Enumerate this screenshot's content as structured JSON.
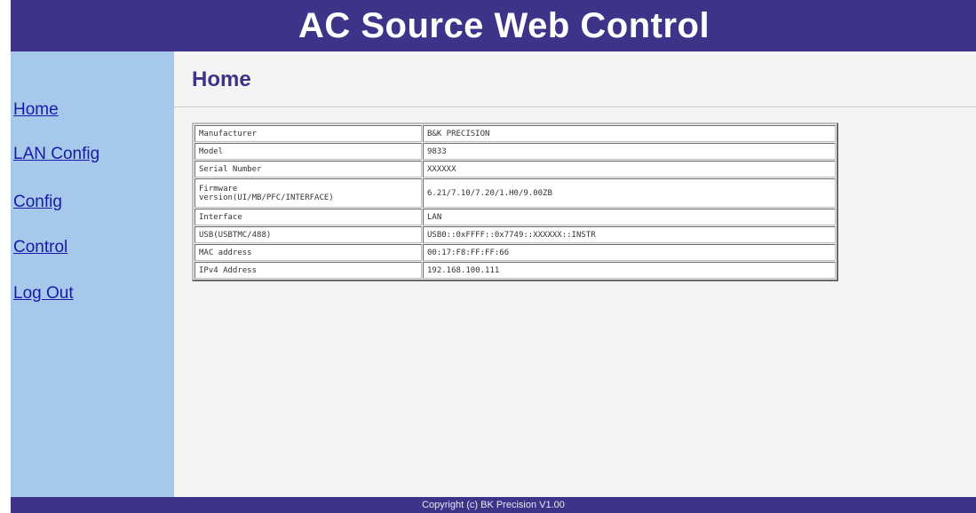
{
  "header": {
    "title": "AC Source Web Control"
  },
  "sidebar": {
    "items": [
      {
        "label": "Home"
      },
      {
        "label": "LAN Config"
      },
      {
        "label": "Config"
      },
      {
        "label": "Control"
      },
      {
        "label": "Log Out"
      }
    ]
  },
  "main": {
    "page_title": "Home",
    "table": {
      "rows": [
        {
          "label": "Manufacturer",
          "value": "B&K PRECISION"
        },
        {
          "label": "Model",
          "value": "9833"
        },
        {
          "label": "Serial Number",
          "value": "XXXXXX"
        },
        {
          "label_line1": "Firmware",
          "label_line2": "version(UI/MB/PFC/INTERFACE)",
          "value": "6.21/7.10/7.20/1.H0/9.00ZB"
        },
        {
          "label": "Interface",
          "value": "LAN"
        },
        {
          "label": "USB(USBTMC/488)",
          "value": "USB0::0xFFFF::0x7749::XXXXXX::INSTR"
        },
        {
          "label": "MAC address",
          "value": "00:17:F8:FF:FF:66"
        },
        {
          "label": "IPv4 Address",
          "value": "192.168.100.111"
        }
      ]
    }
  },
  "footer": {
    "copyright": "Copyright (c) BK Precision V1.00"
  }
}
